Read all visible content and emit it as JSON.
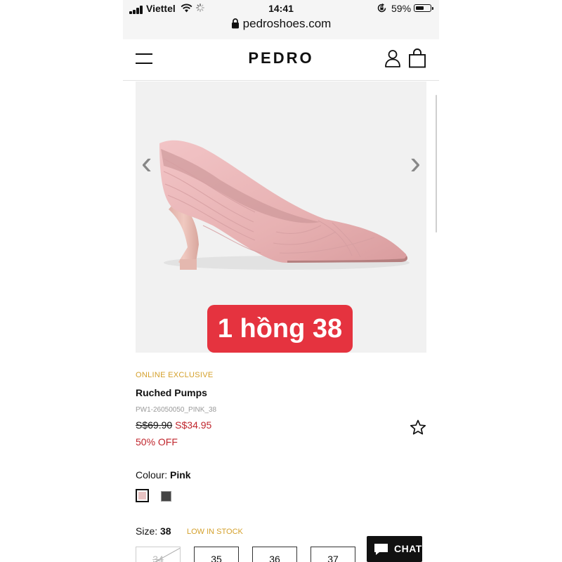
{
  "status_bar": {
    "carrier": "Viettel",
    "time": "14:41",
    "battery": "59%",
    "battery_level": 0.59,
    "url": "pedroshoes.com"
  },
  "header": {
    "logo": "PEDRO",
    "icons": [
      "menu-icon",
      "user-icon",
      "shopping-bag-icon"
    ]
  },
  "gallery": {
    "sticker": "1 hồng 38",
    "prev_icon": "chevron-left-icon",
    "next_icon": "chevron-right-icon"
  },
  "product": {
    "tag": "ONLINE EXCLUSIVE",
    "name": "Ruched Pumps",
    "sku": "PW1-26050050_PINK_38",
    "old_price": "S$69.90",
    "new_price": "S$34.95",
    "discount": "50% OFF",
    "wishlist_icon": "star-icon"
  },
  "colour": {
    "label": "Colour:",
    "value": "Pink",
    "swatches": [
      {
        "name": "Pink",
        "color": "#e8c3c3",
        "selected": true
      },
      {
        "name": "Black",
        "color": "#444444",
        "selected": false
      }
    ]
  },
  "size": {
    "label": "Size:",
    "value": "38",
    "stock": "LOW IN STOCK",
    "options": [
      {
        "label": "34",
        "available": false
      },
      {
        "label": "35",
        "available": true
      },
      {
        "label": "36",
        "available": true
      },
      {
        "label": "37",
        "available": true
      }
    ]
  },
  "chat": {
    "label": "CHAT"
  },
  "colors": {
    "accent_gold": "#d4a02b",
    "sale_red": "#c0262d",
    "sticker_red": "#e5333f"
  }
}
